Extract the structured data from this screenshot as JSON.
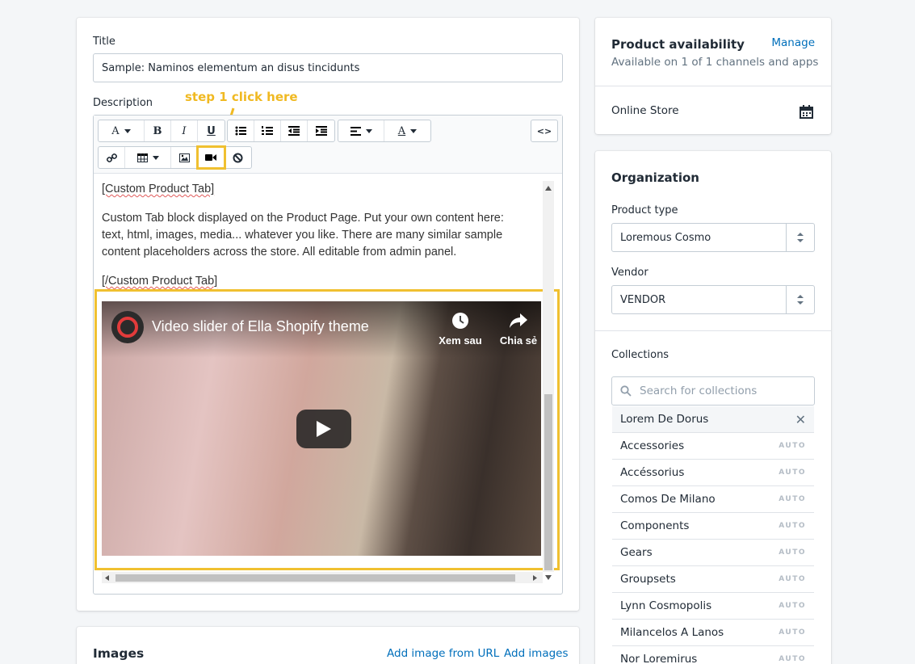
{
  "product": {
    "title_label": "Title",
    "title_value": "Sample: Naminos elementum  an disus tincidunts",
    "description_label": "Description",
    "annotation": "step 1 click here",
    "editor": {
      "para1": "[Custom Product Tab]",
      "para2": "Custom Tab block displayed on the Product Page. Put your own content here: text, html, images, media... whatever you like. There are many similar sample content placeholders across the store. All editable from admin panel.",
      "para3": "[/Custom Product Tab]",
      "toolbar": {
        "font": "A",
        "bold": "B",
        "italic": "I",
        "underline": "U",
        "color": "A",
        "code": "<>"
      }
    },
    "video": {
      "title": "Video slider of Ella Shopify theme",
      "watch_later": "Xem sau",
      "share": "Chia sẻ"
    }
  },
  "images": {
    "heading": "Images",
    "add_from_url": "Add image from URL",
    "add_images": "Add images"
  },
  "availability": {
    "heading": "Product availability",
    "manage": "Manage",
    "subtext": "Available on 1 of 1 channels and apps",
    "channel": "Online Store"
  },
  "organization": {
    "heading": "Organization",
    "product_type_label": "Product type",
    "product_type_value": "Loremous Cosmo",
    "vendor_label": "Vendor",
    "vendor_value": "VENDOR",
    "collections_label": "Collections",
    "search_placeholder": "Search for collections",
    "selected": "Lorem De Dorus",
    "auto_tag": "AUTO",
    "collections": [
      "Accessories",
      "Accéssorius",
      "Comos De Milano",
      "Components",
      "Gears",
      "Groupsets",
      "Lynn Cosmopolis",
      "Milancelos A Lanos",
      "Nor Loremirus"
    ]
  },
  "colors": {
    "accent": "#006fbb",
    "highlight": "#f0c030",
    "annotation": "#f0b921"
  }
}
